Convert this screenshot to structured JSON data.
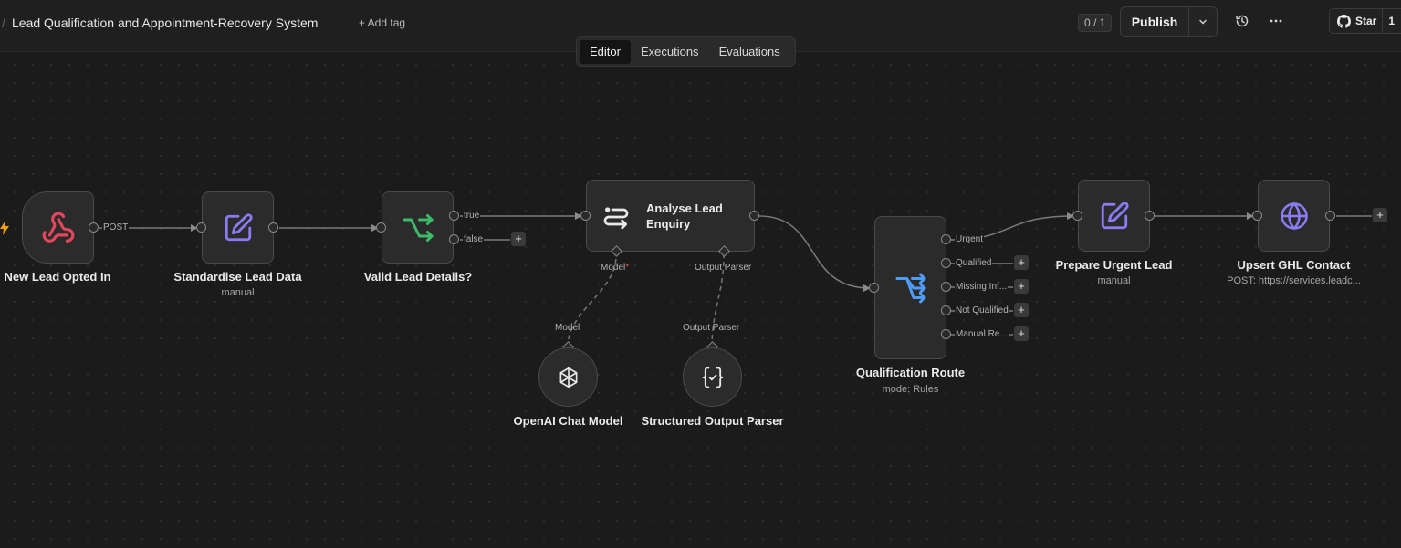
{
  "header": {
    "workflow_title": "Lead Qualification and Appointment-Recovery System",
    "add_tag_label": "+ Add tag",
    "counter": "0 / 1",
    "publish_label": "Publish",
    "star_label": "Star",
    "star_count": "1"
  },
  "tabs": [
    {
      "label": "Editor",
      "active": true
    },
    {
      "label": "Executions",
      "active": false
    },
    {
      "label": "Evaluations",
      "active": false
    }
  ],
  "nodes": {
    "trigger": {
      "label": "New Lead Opted In",
      "edge_label": "POST"
    },
    "standardise": {
      "label": "Standardise Lead Data",
      "subtitle": "manual"
    },
    "valid": {
      "label": "Valid Lead Details?",
      "out_true": "true",
      "out_false": "false"
    },
    "analyse": {
      "label": "Analyse Lead Enquiry",
      "port_model": "Model",
      "port_model_required": "*",
      "port_parser": "Output Parser"
    },
    "openai": {
      "label": "OpenAI Chat Model",
      "port_label": "Model"
    },
    "parser": {
      "label": "Structured Output Parser",
      "port_label": "Output Parser"
    },
    "route": {
      "label": "Qualification Route",
      "subtitle": "mode: Rules",
      "outputs": [
        "Urgent",
        "Qualified",
        "Missing Inf...",
        "Not Qualified",
        "Manual Re..."
      ]
    },
    "prepare": {
      "label": "Prepare Urgent Lead",
      "subtitle": "manual"
    },
    "upsert": {
      "label": "Upsert GHL Contact",
      "subtitle": "POST: https://services.leadc..."
    }
  },
  "colors": {
    "webhook": "#e2475c",
    "edit": "#8b7cf6",
    "if": "#3dbb6a",
    "switch": "#4f9cf6",
    "http": "#8b7cf6",
    "trigger_bolt": "#f59e0b"
  }
}
